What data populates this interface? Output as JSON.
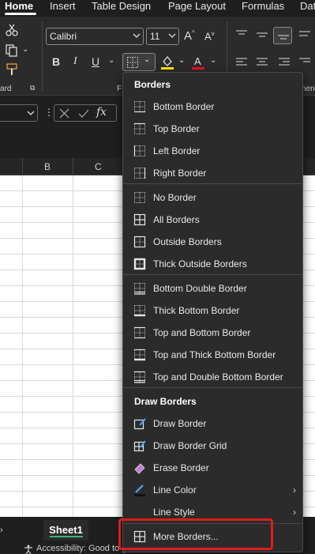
{
  "ribbon_tabs": [
    "Home",
    "Insert",
    "Table Design",
    "Page Layout",
    "Formulas",
    "Dat"
  ],
  "ribbon": {
    "font_name": "Calibri",
    "font_size": "11",
    "group_clipboard": "ard",
    "group_font": "F",
    "group_alignment": "nen"
  },
  "formula_bar": {
    "fx": "fx"
  },
  "columns": [
    "B",
    "C"
  ],
  "menu": {
    "header_borders": "Borders",
    "items_borders": [
      {
        "label": "Bottom Border",
        "icon": "bottom-border-icon"
      },
      {
        "label": "Top Border",
        "icon": "top-border-icon"
      },
      {
        "label": "Left Border",
        "icon": "left-border-icon"
      },
      {
        "label": "Right Border",
        "icon": "right-border-icon"
      },
      {
        "label": "No Border",
        "icon": "no-border-icon"
      },
      {
        "label": "All Borders",
        "icon": "all-borders-icon"
      },
      {
        "label": "Outside Borders",
        "icon": "outside-borders-icon"
      },
      {
        "label": "Thick Outside Borders",
        "icon": "thick-outside-borders-icon"
      },
      {
        "label": "Bottom Double Border",
        "icon": "bottom-double-border-icon"
      },
      {
        "label": "Thick Bottom Border",
        "icon": "thick-bottom-border-icon"
      },
      {
        "label": "Top and Bottom Border",
        "icon": "top-bottom-border-icon"
      },
      {
        "label": "Top and Thick Bottom Border",
        "icon": "top-thick-bottom-border-icon"
      },
      {
        "label": "Top and Double Bottom Border",
        "icon": "top-double-bottom-border-icon"
      }
    ],
    "header_draw": "Draw Borders",
    "items_draw": [
      {
        "label": "Draw Border",
        "icon": "draw-border-icon"
      },
      {
        "label": "Draw Border Grid",
        "icon": "draw-border-grid-icon"
      },
      {
        "label": "Erase Border",
        "icon": "eraser-icon"
      },
      {
        "label": "Line Color",
        "icon": "line-color-icon"
      },
      {
        "label": "Line Style",
        "icon": "line-style-icon"
      },
      {
        "label": "More Borders...",
        "icon": "more-borders-icon"
      }
    ]
  },
  "sheet_tab": "Sheet1",
  "status_text": "Accessibility: Good to go",
  "colors": {
    "highlight": "#e21b1b",
    "font_color_bar": "#e81123",
    "fill_color_bar": "#ffe600",
    "sheet_accent": "#3fb27f"
  }
}
